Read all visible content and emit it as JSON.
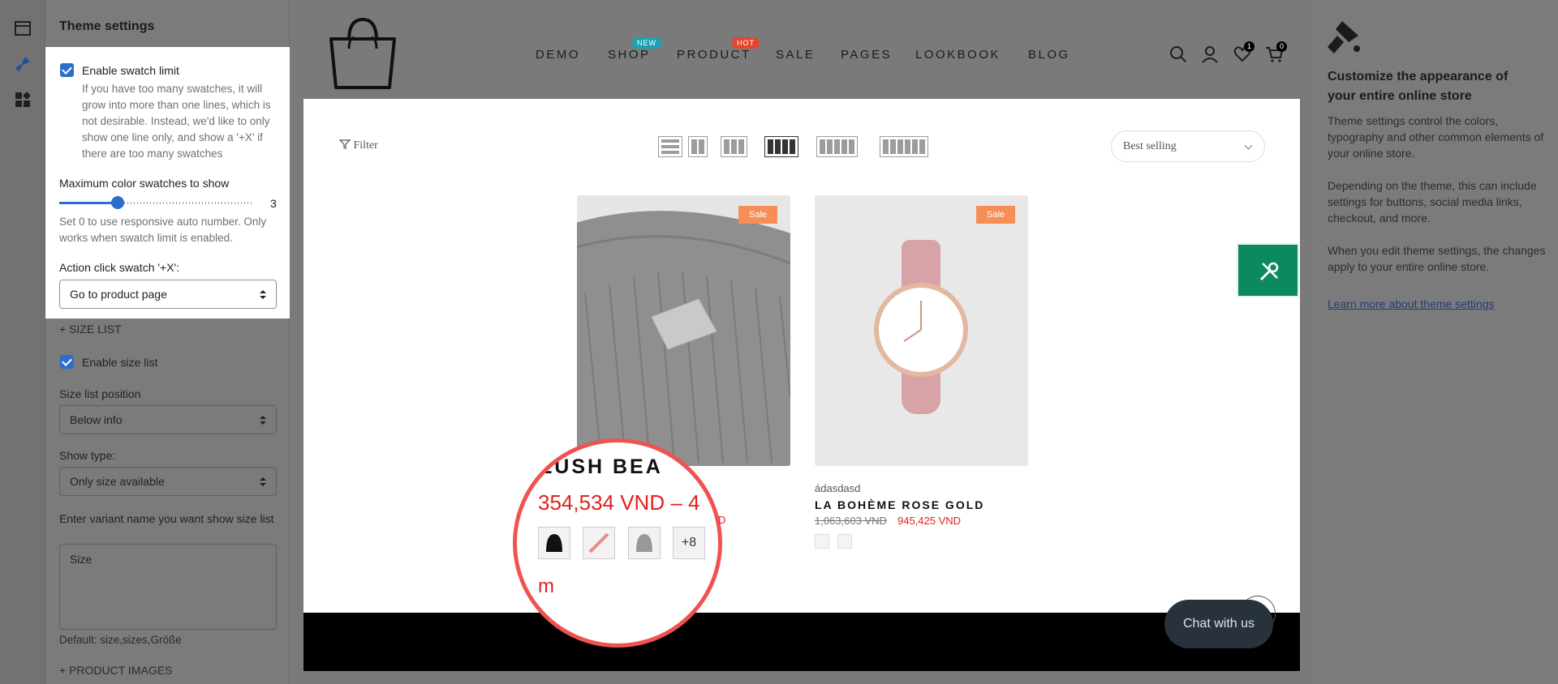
{
  "rail": {
    "icons": [
      "sections-icon",
      "brush-icon",
      "apps-icon"
    ]
  },
  "panel": {
    "title": "Theme settings",
    "enable_swatch_limit": {
      "label": "Enable swatch limit",
      "checked": true,
      "help": "If you have too many swatches, it will grow into more than one lines, which is not desirable. Instead, we'd like to only show one line only, and show a '+X' if there are too many swatches"
    },
    "max_swatches": {
      "label": "Maximum color swatches to show",
      "value": "3",
      "fraction": 0.3,
      "help": "Set 0 to use responsive auto number. Only works when swatch limit is enabled."
    },
    "action_click": {
      "label": "Action click swatch '+X':",
      "value": "Go to product page"
    },
    "size_list_heading": "+ SIZE LIST",
    "enable_size_list": {
      "label": "Enable size list",
      "checked": true
    },
    "size_list_position": {
      "label": "Size list position",
      "value": "Below info"
    },
    "show_type": {
      "label": "Show type:",
      "value": "Only size available"
    },
    "variant_name": {
      "label": "Enter variant name you want show size list",
      "value": "Size",
      "help": "Default: size,sizes,Größe"
    },
    "product_images_heading": "+ PRODUCT IMAGES"
  },
  "header": {
    "nav": [
      "DEMO",
      "SHOP",
      "PRODUCT",
      "SALE",
      "PAGES",
      "LOOKBOOK",
      "BLOG"
    ],
    "badges": {
      "shop": "NEW",
      "product": "HOT"
    },
    "wishlist_count": "1",
    "cart_count": "0",
    "colors": {
      "new_badge": "#1aa1b5",
      "hot_badge": "#e2462c"
    }
  },
  "toolbar": {
    "filter_label": "Filter",
    "sort_value": "Best selling"
  },
  "products": [
    {
      "badge": "Sale",
      "name_zoomed": "LUSH BEA",
      "price_zoomed": "354,534 VND – 4",
      "price_tail": "D",
      "more_label": "+8",
      "zoom_extra": "m"
    },
    {
      "badge": "Sale",
      "vendor": "ádasdasd",
      "name": "LA BOHÈME ROSE GOLD",
      "old_price": "1,063,603 VND",
      "new_price": "945,425 VND"
    }
  ],
  "chat": {
    "label": "Chat with us"
  },
  "info": {
    "title": "Customize the appearance of your entire online store",
    "p1": "Theme settings control the colors, typography and other common elements of your online store.",
    "p2": "Depending on the theme, this can include settings for buttons, social media links, checkout, and more.",
    "p3": "When you edit theme settings, the changes apply to your entire online store.",
    "link": "Learn more about theme settings"
  }
}
